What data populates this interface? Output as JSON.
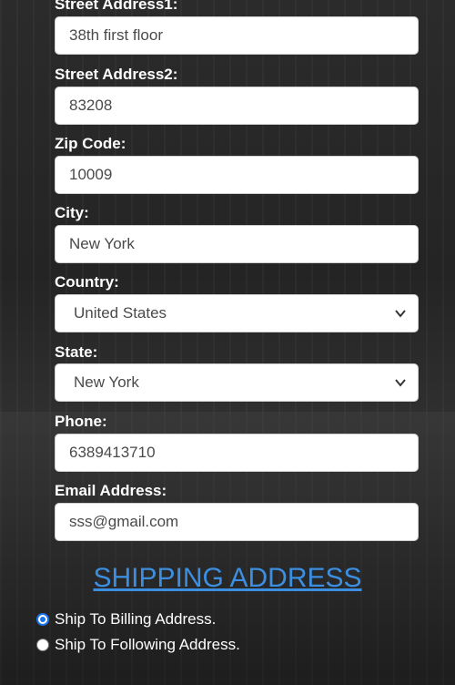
{
  "billing": {
    "street1": {
      "label": "Street Address1:",
      "value": "38th first floor"
    },
    "street2": {
      "label": "Street Address2:",
      "value": "83208"
    },
    "zip": {
      "label": "Zip Code:",
      "value": "10009"
    },
    "city": {
      "label": "City:",
      "value": "New York"
    },
    "country": {
      "label": "Country:",
      "selected": "United States"
    },
    "state": {
      "label": "State:",
      "selected": "New York"
    },
    "phone": {
      "label": "Phone:",
      "value": "6389413710"
    },
    "email": {
      "label": "Email Address:",
      "value": "sss@gmail.com"
    }
  },
  "shipping": {
    "heading": "SHIPPING ADDRESS",
    "options": [
      {
        "label": "Ship To Billing Address.",
        "checked": true
      },
      {
        "label": "Ship To Following Address.",
        "checked": false
      }
    ]
  }
}
